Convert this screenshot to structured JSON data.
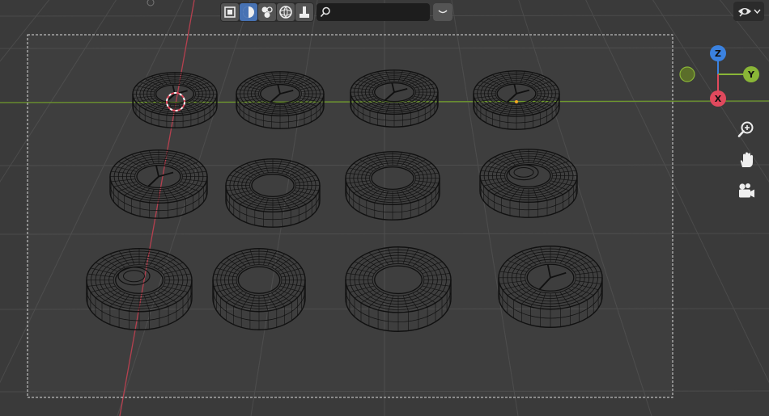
{
  "header": {
    "shading_modes": [
      {
        "name": "wireframe-shading-icon",
        "active": false
      },
      {
        "name": "solid-shading-icon",
        "active": true
      },
      {
        "name": "material-preview-icon",
        "active": false
      },
      {
        "name": "rendered-shading-icon",
        "active": false
      },
      {
        "name": "shading-options-icon",
        "active": false
      }
    ],
    "search": {
      "value": "",
      "placeholder": ""
    }
  },
  "gizmo": {
    "z": "Z",
    "y": "Y",
    "x": "X"
  },
  "colors": {
    "background": "#3a3a3a",
    "x_axis": "#e0495d",
    "y_axis": "#8ab637",
    "z_axis": "#3b82e0",
    "active_button": "#4772b3",
    "wire": "#111111"
  },
  "navigation": [
    "zoom-icon",
    "pan-hand-icon",
    "camera-view-icon"
  ]
}
